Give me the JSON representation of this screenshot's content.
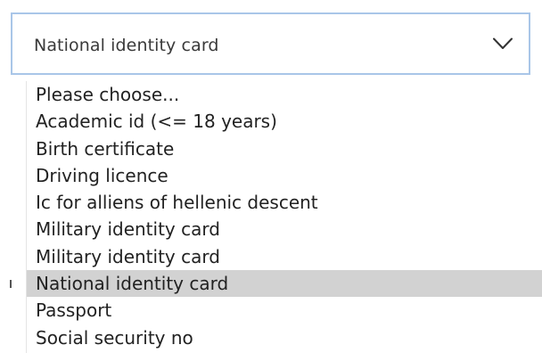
{
  "select": {
    "current_value": "National identity card",
    "icon": "chevron-down-icon"
  },
  "dropdown": {
    "options": [
      "Please choose...",
      "Academic id (<= 18 years)",
      "Birth certificate",
      "Driving licence",
      "Ic for alliens of hellenic descent",
      "Military identity card",
      "Military identity card",
      "National identity card",
      "Passport",
      "Social security no"
    ],
    "selected_index": 7
  },
  "colors": {
    "border": "#a9c6e8",
    "selected_bg": "#d2d2d2",
    "text": "#222222"
  }
}
